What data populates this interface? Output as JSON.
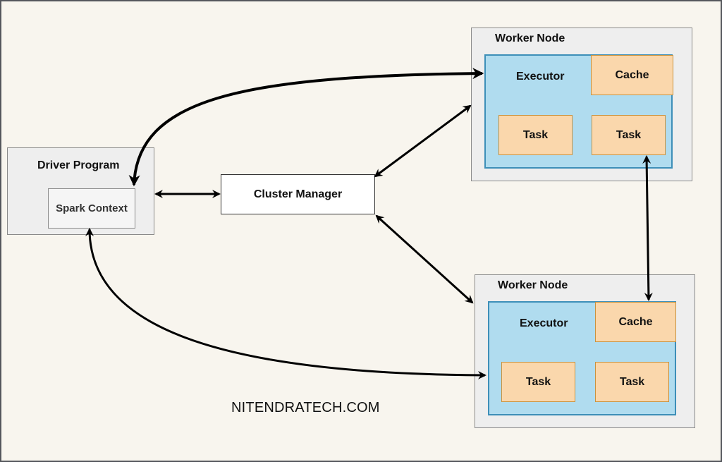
{
  "driver": {
    "title": "Driver Program",
    "context": "Spark Context"
  },
  "cluster_manager": {
    "label": "Cluster Manager"
  },
  "worker_nodes": [
    {
      "title": "Worker Node",
      "executor": "Executor",
      "cache": "Cache",
      "tasks": [
        "Task",
        "Task"
      ]
    },
    {
      "title": "Worker Node",
      "executor": "Executor",
      "cache": "Cache",
      "tasks": [
        "Task",
        "Task"
      ]
    }
  ],
  "watermark": "NITENDRATECH.COM",
  "colors": {
    "background": "#f8f5ee",
    "executor": "#b0dcef",
    "executor_border": "#3d8fb8",
    "task": "#fad7ac",
    "node": "#eeeeee"
  }
}
